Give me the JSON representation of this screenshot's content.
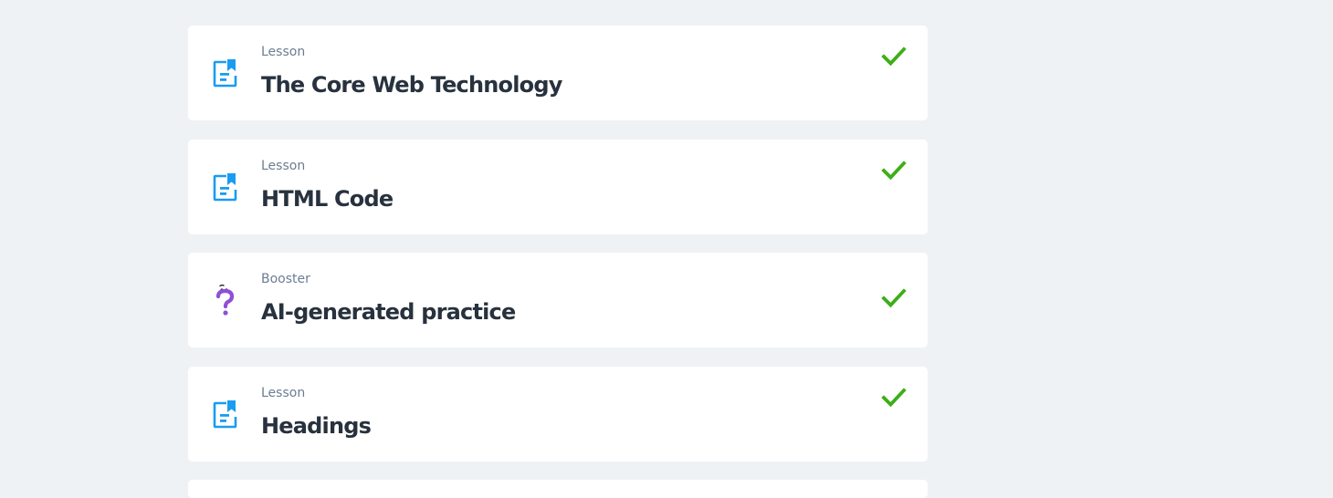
{
  "colors": {
    "page_background": "#eff2f5",
    "card_background": "#ffffff",
    "lesson_icon": "#1a9cf0",
    "booster_icon": "#8e4fd8",
    "check": "#3caf16",
    "kind_text": "#6b7d92",
    "title_text": "#28323e"
  },
  "items": [
    {
      "kind": "Lesson",
      "title": "The Core Web Technology",
      "icon": "lesson-document-icon",
      "status_icon": "checkmark-icon",
      "completed": true
    },
    {
      "kind": "Lesson",
      "title": "HTML Code",
      "icon": "lesson-document-icon",
      "status_icon": "checkmark-icon",
      "completed": true
    },
    {
      "kind": "Booster",
      "title": "AI-generated practice",
      "icon": "booster-question-icon",
      "status_icon": "checkmark-icon",
      "completed": true
    },
    {
      "kind": "Lesson",
      "title": "Headings",
      "icon": "lesson-document-icon",
      "status_icon": "checkmark-icon",
      "completed": true
    }
  ]
}
